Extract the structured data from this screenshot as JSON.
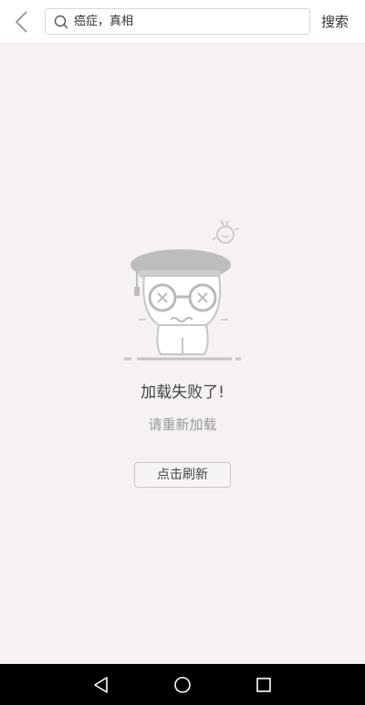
{
  "header": {
    "back_icon": "chevron-left-icon",
    "search": {
      "icon": "search-icon",
      "value": "癌症，真相"
    },
    "search_button_label": "搜索"
  },
  "error": {
    "illustration": "graduate-mascot-illustration",
    "title": "加载失败了!",
    "subtitle": "请重新加载",
    "refresh_label": "点击刷新"
  },
  "navbar": {
    "back_icon": "triangle-back-icon",
    "home_icon": "circle-home-icon",
    "recents_icon": "square-recents-icon"
  },
  "colors": {
    "background": "#f5f1f5",
    "header": "#ffffff",
    "navbar": "#000000",
    "mascot_gray": "#bdbdbd"
  }
}
